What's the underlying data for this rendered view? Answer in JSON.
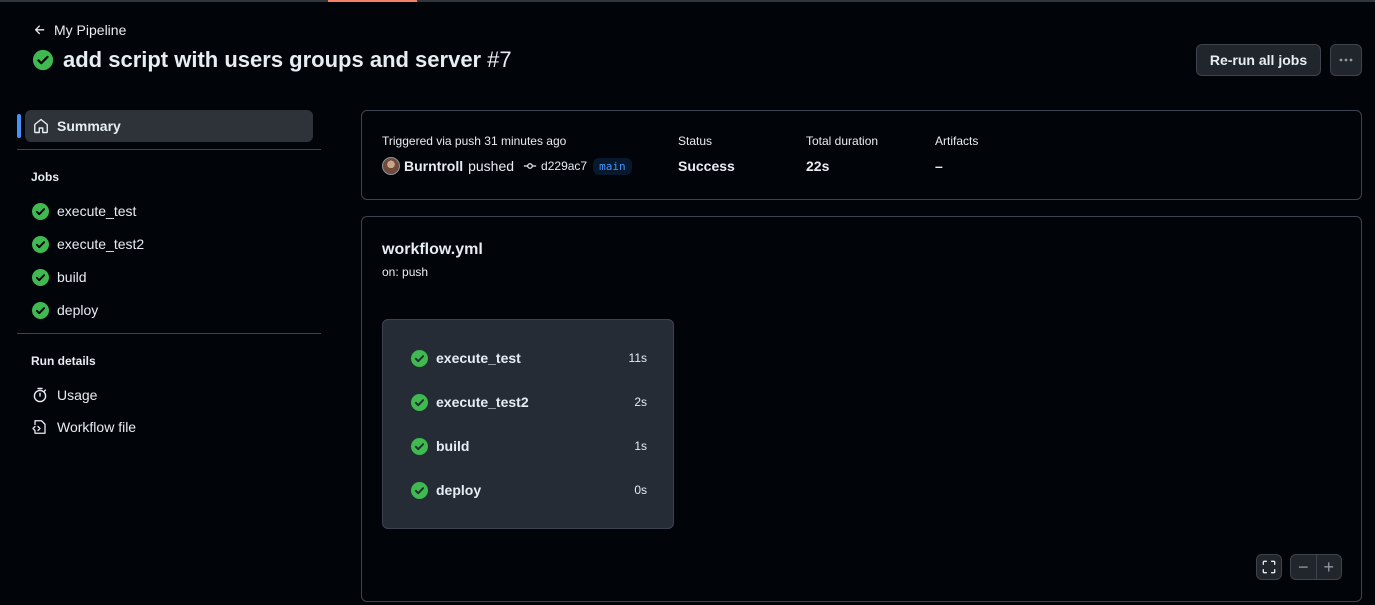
{
  "header": {
    "back_label": "My Pipeline",
    "title": "add script with users groups and server",
    "run_number": "#7",
    "rerun_label": "Re-run all jobs",
    "status_icon": "check-circle-fill-icon",
    "more_icon": "kebab-horizontal-icon"
  },
  "sidebar": {
    "summary_label": "Summary",
    "summary_icon": "home-icon",
    "jobs_heading": "Jobs",
    "jobs": [
      {
        "label": "execute_test",
        "status": "success"
      },
      {
        "label": "execute_test2",
        "status": "success"
      },
      {
        "label": "build",
        "status": "success"
      },
      {
        "label": "deploy",
        "status": "success"
      }
    ],
    "run_details_heading": "Run details",
    "details": [
      {
        "label": "Usage",
        "icon": "stopwatch-icon"
      },
      {
        "label": "Workflow file",
        "icon": "file-code-icon"
      }
    ]
  },
  "summary_card": {
    "trigger_label": "Triggered via push 31 minutes ago",
    "actor": "Burntroll",
    "action": "pushed",
    "commit_sha": "d229ac7",
    "branch": "main",
    "status_label": "Status",
    "status_value": "Success",
    "duration_label": "Total duration",
    "duration_value": "22s",
    "artifacts_label": "Artifacts",
    "artifacts_value": "–"
  },
  "workflow": {
    "file_name": "workflow.yml",
    "trigger": "on: push",
    "jobs": [
      {
        "name": "execute_test",
        "duration": "11s"
      },
      {
        "name": "execute_test2",
        "duration": "2s"
      },
      {
        "name": "build",
        "duration": "1s"
      },
      {
        "name": "deploy",
        "duration": "0s"
      }
    ],
    "zoom_out_label": "−",
    "zoom_in_label": "+",
    "fullscreen_icon": "screen-full-icon"
  },
  "colors": {
    "success": "#3fb950",
    "accent": "#4493f8",
    "tab_underline": "#f78166",
    "background": "#010409"
  }
}
